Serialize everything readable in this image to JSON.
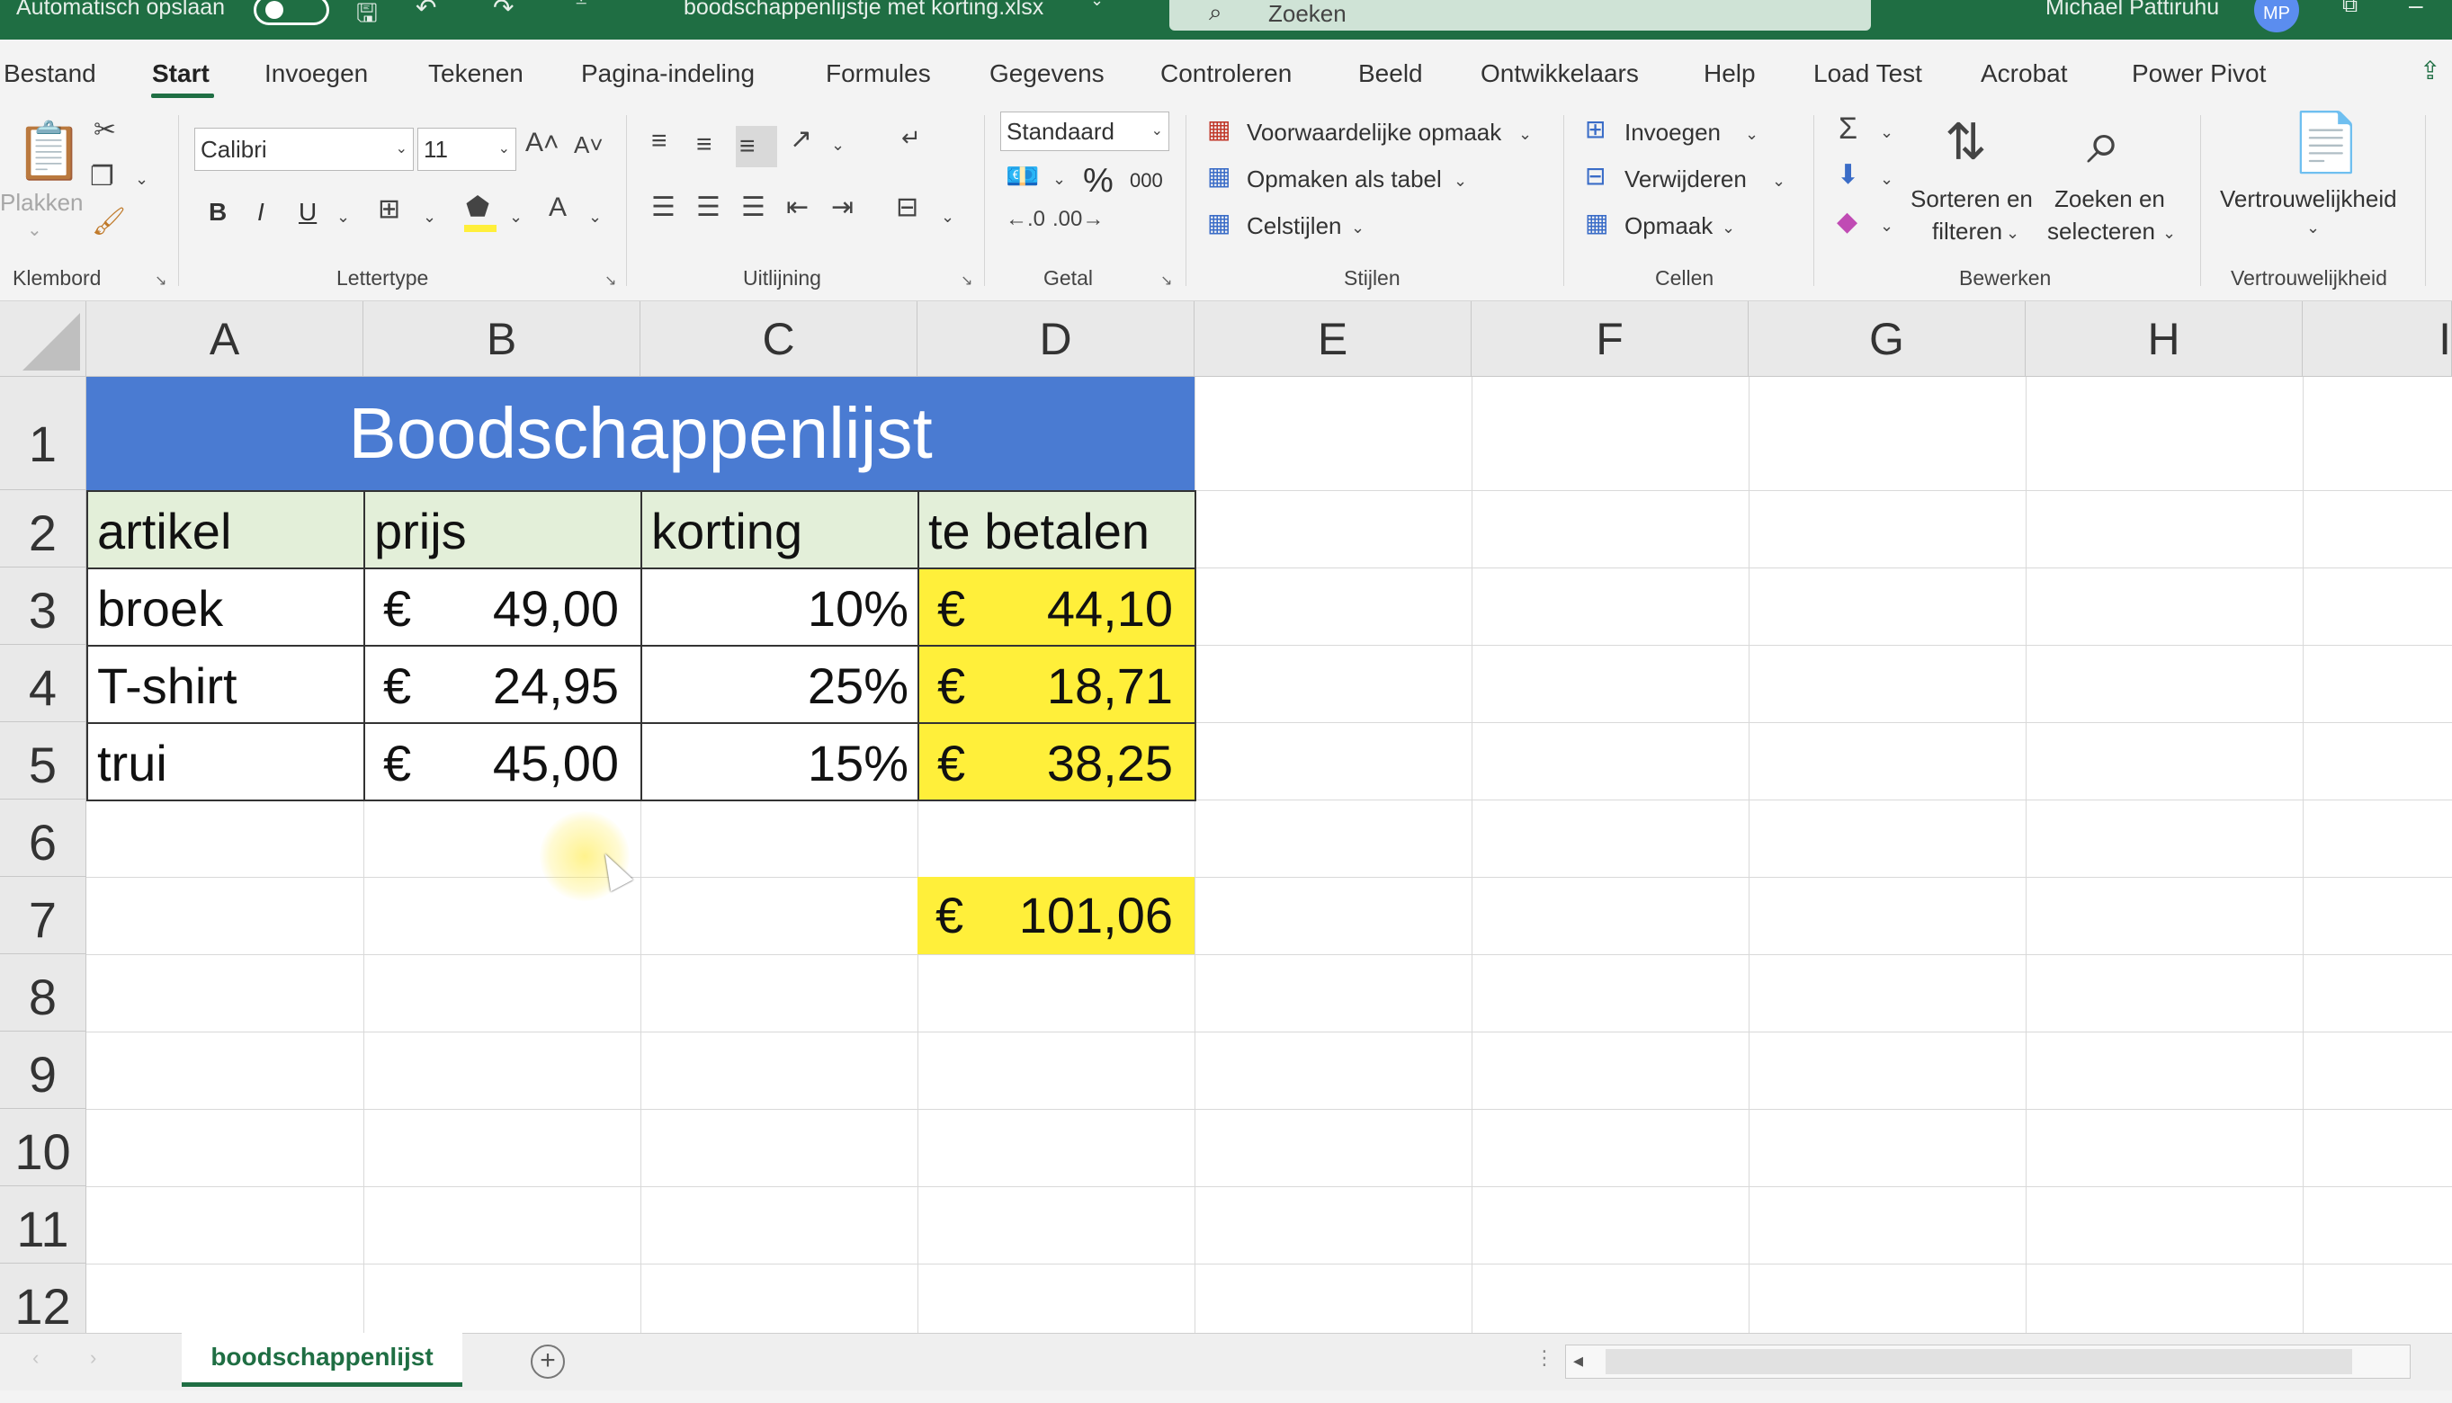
{
  "titlebar": {
    "autosave_label": "Automatisch opslaan",
    "filename": "boodschappenlijstje met korting.xlsx",
    "search_placeholder": "Zoeken",
    "user_name": "Michael Pattiruhu",
    "user_initials": "MP"
  },
  "tabs": [
    "Bestand",
    "Start",
    "Invoegen",
    "Tekenen",
    "Pagina-indeling",
    "Formules",
    "Gegevens",
    "Controleren",
    "Beeld",
    "Ontwikkelaars",
    "Help",
    "Load Test",
    "Acrobat",
    "Power Pivot"
  ],
  "active_tab": "Start",
  "ribbon": {
    "clipboard": {
      "paste": "Plakken",
      "label": "Klembord"
    },
    "font": {
      "name": "Calibri",
      "size": "11",
      "bold": "B",
      "italic": "I",
      "underline": "U",
      "label": "Lettertype"
    },
    "alignment": {
      "label": "Uitlijning"
    },
    "number": {
      "format": "Standaard",
      "percent": "%",
      "thousands": "000",
      "label": "Getal"
    },
    "styles": {
      "conditional": "Voorwaardelijke opmaak",
      "as_table": "Opmaken als tabel",
      "cell_styles": "Celstijlen",
      "label": "Stijlen"
    },
    "cells": {
      "insert": "Invoegen",
      "delete": "Verwijderen",
      "format": "Opmaak",
      "label": "Cellen"
    },
    "editing": {
      "sort_line1": "Sorteren en",
      "sort_line2": "filteren",
      "find_line1": "Zoeken en",
      "find_line2": "selecteren",
      "label": "Bewerken"
    },
    "sensitivity": {
      "button": "Vertrouwelijkheid",
      "label": "Vertrouwelijkheid"
    }
  },
  "columns": [
    "A",
    "B",
    "C",
    "D",
    "E",
    "F",
    "G",
    "H",
    "I"
  ],
  "rows": [
    "1",
    "2",
    "3",
    "4",
    "5",
    "6",
    "7",
    "8",
    "9",
    "10",
    "11",
    "12"
  ],
  "sheet": {
    "title": "Boodschappenlijst",
    "headers": {
      "a": "artikel",
      "b": "prijs",
      "c": "korting",
      "d": "te betalen"
    },
    "items": [
      {
        "artikel": "broek",
        "prijs": "49,00",
        "korting": "10%",
        "te_betalen": "44,10"
      },
      {
        "artikel": "T-shirt",
        "prijs": "24,95",
        "korting": "25%",
        "te_betalen": "18,71"
      },
      {
        "artikel": "trui",
        "prijs": "45,00",
        "korting": "15%",
        "te_betalen": "38,25"
      }
    ],
    "currency_symbol": "€",
    "total": "101,06"
  },
  "sheet_tab": "boodschappenlijst",
  "colors": {
    "accent": "#1f6e43",
    "title_fill": "#4a7bd2",
    "header_fill": "#e3efd9",
    "highlight_fill": "#ffef3a"
  }
}
